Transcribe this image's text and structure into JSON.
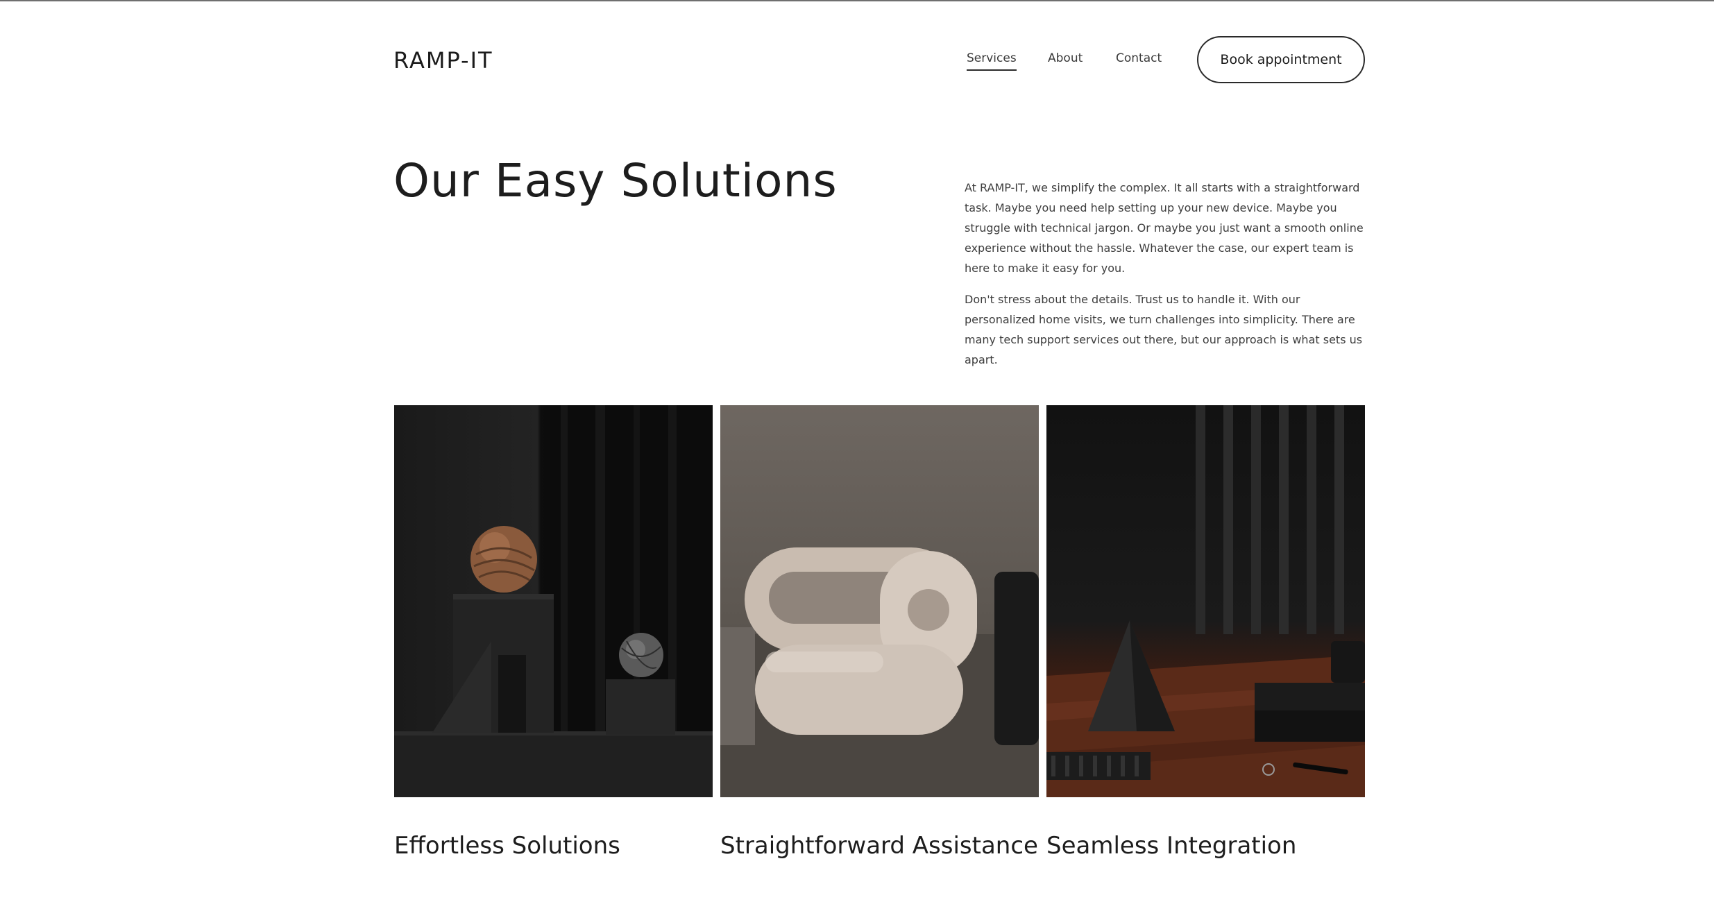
{
  "brand": {
    "logo": "RAMP-IT"
  },
  "nav": {
    "items": [
      {
        "label": "Services",
        "active": true
      },
      {
        "label": "About",
        "active": false
      },
      {
        "label": "Contact",
        "active": false
      }
    ],
    "cta_label": "Book appointment"
  },
  "hero": {
    "title": "Our Easy Solutions",
    "paragraphs": [
      "At RAMP-IT, we simplify the complex. It all starts with a straightforward task. Maybe you need help setting up your new device. Maybe you struggle with technical jargon. Or maybe you just want a smooth online experience without the hassle. Whatever the case, our expert team is here to make it easy for you.",
      "Don't stress about the details. Trust us to handle it. With our personalized home visits, we turn challenges into simplicity. There are many tech support services out there, but our approach is what sets us apart."
    ]
  },
  "cards": [
    {
      "title": "Effortless Solutions",
      "image": "dark-sculpture-spheres-image"
    },
    {
      "title": "Straightforward Assistance",
      "image": "beige-lounge-chair-image"
    },
    {
      "title": "Seamless Integration",
      "image": "pyramid-wooden-desk-image"
    }
  ],
  "colors": {
    "text": "#1c1c1c",
    "body_text": "#3d3d3d",
    "background": "#ffffff"
  }
}
